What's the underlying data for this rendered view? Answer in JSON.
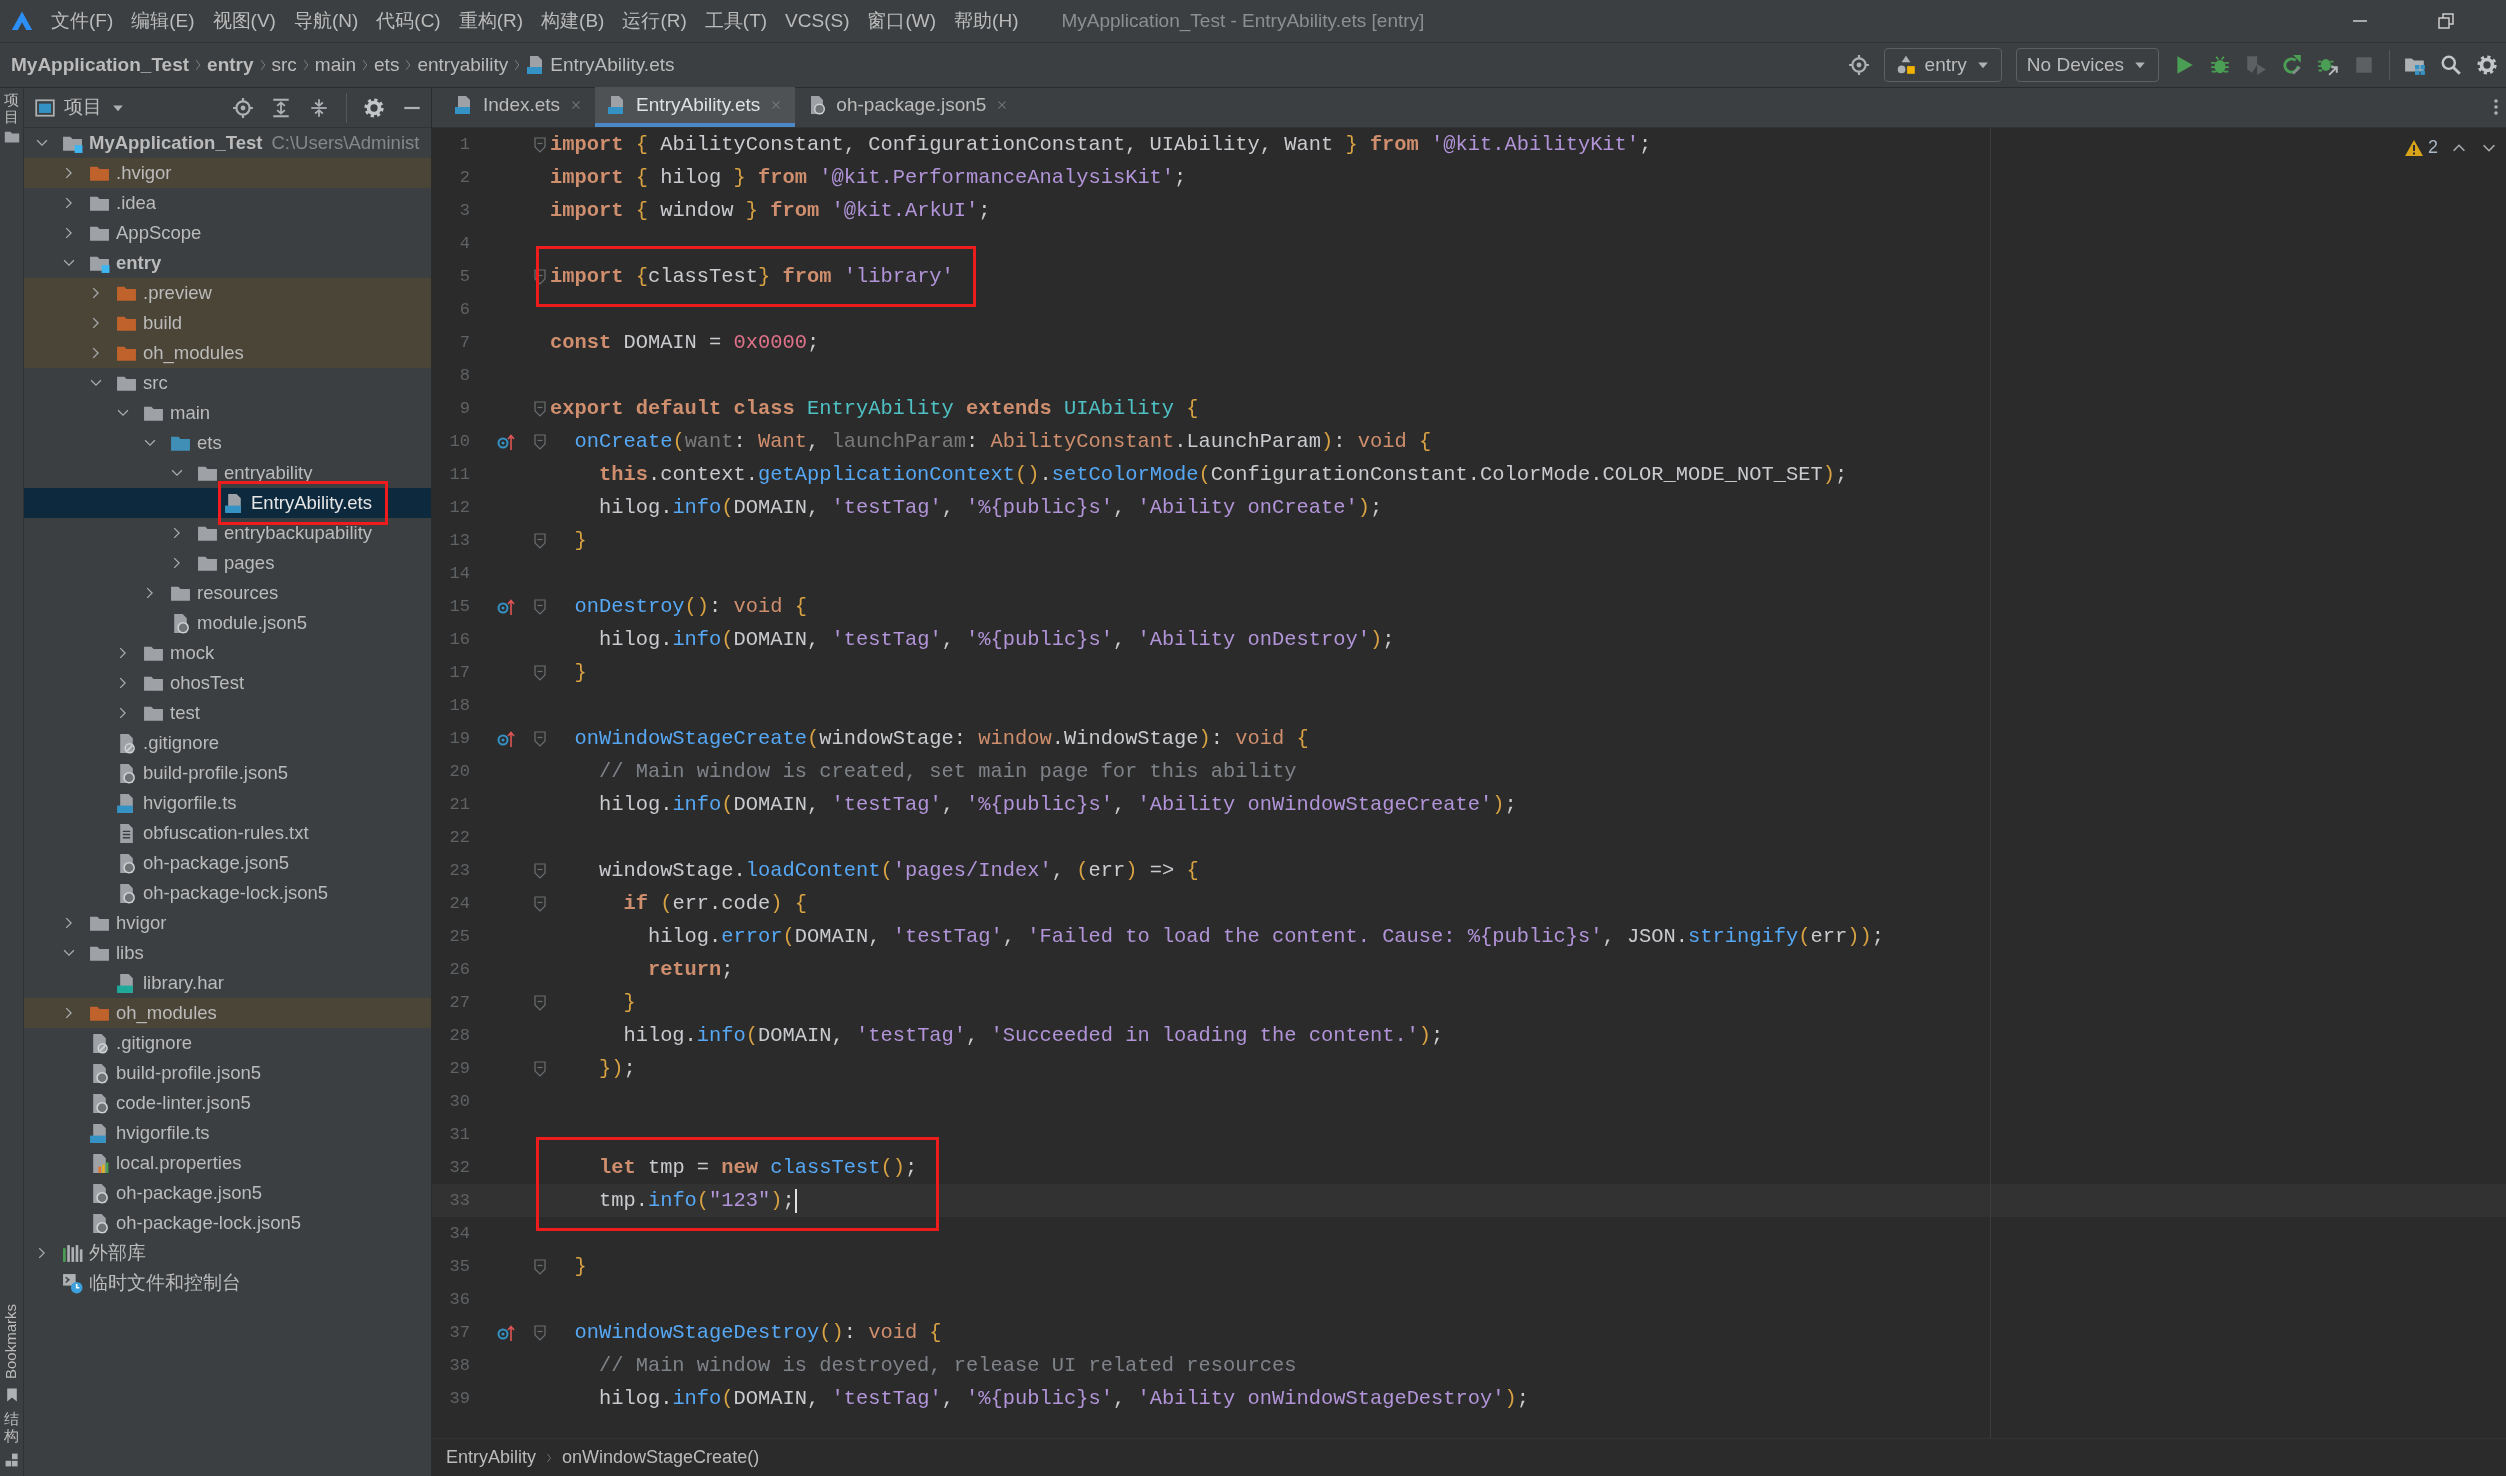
{
  "title_bar": {
    "menus": [
      "文件(F)",
      "编辑(E)",
      "视图(V)",
      "导航(N)",
      "代码(C)",
      "重构(R)",
      "构建(B)",
      "运行(R)",
      "工具(T)",
      "VCS(S)",
      "窗口(W)",
      "帮助(H)"
    ],
    "title": "MyApplication_Test - EntryAbility.ets [entry]"
  },
  "navigation_bar": {
    "breadcrumb": [
      {
        "label": "MyApplication_Test",
        "kind": "module"
      },
      {
        "label": "entry",
        "kind": "module"
      },
      {
        "label": "src",
        "kind": "dir"
      },
      {
        "label": "main",
        "kind": "dir"
      },
      {
        "label": "ets",
        "kind": "dir"
      },
      {
        "label": "entryability",
        "kind": "dir"
      },
      {
        "label": "EntryAbility.ets",
        "kind": "ets"
      }
    ],
    "run_config": "entry",
    "device": "No Devices"
  },
  "tool_strip": {
    "top_tab": "项目",
    "bottom_tabs": [
      {
        "label": "Bookmarks",
        "kind": "bookmarks"
      },
      {
        "label": "结构",
        "kind": "structure"
      }
    ]
  },
  "project_panel": {
    "title": "项目",
    "tree": [
      {
        "label": "MyApplication_Test",
        "kind": "module",
        "hint": "C:\\Users\\Administ",
        "expanded": true,
        "excluded": false,
        "selected": false,
        "boxed": false,
        "children": [
          {
            "label": ".hvigor",
            "kind": "folder",
            "expanded": false,
            "excluded": true,
            "selected": false,
            "boxed": false
          },
          {
            "label": ".idea",
            "kind": "folder",
            "expanded": false,
            "excluded": false,
            "selected": false,
            "boxed": false
          },
          {
            "label": "AppScope",
            "kind": "folder",
            "expanded": false,
            "excluded": false,
            "selected": false,
            "boxed": false
          },
          {
            "label": "entry",
            "kind": "module",
            "expanded": true,
            "excluded": false,
            "selected": false,
            "boxed": false,
            "children": [
              {
                "label": ".preview",
                "kind": "folder",
                "expanded": false,
                "excluded": true,
                "selected": false,
                "boxed": false
              },
              {
                "label": "build",
                "kind": "folder",
                "expanded": false,
                "excluded": true,
                "selected": false,
                "boxed": false
              },
              {
                "label": "oh_modules",
                "kind": "folder",
                "expanded": false,
                "excluded": true,
                "selected": false,
                "boxed": false
              },
              {
                "label": "src",
                "kind": "folder",
                "expanded": true,
                "excluded": false,
                "selected": false,
                "boxed": false,
                "children": [
                  {
                    "label": "main",
                    "kind": "folder",
                    "expanded": true,
                    "excluded": false,
                    "selected": false,
                    "boxed": false,
                    "children": [
                      {
                        "label": "ets",
                        "kind": "source",
                        "expanded": true,
                        "excluded": false,
                        "selected": false,
                        "boxed": false,
                        "children": [
                          {
                            "label": "entryability",
                            "kind": "folder",
                            "expanded": true,
                            "excluded": false,
                            "selected": false,
                            "boxed": false,
                            "children": [
                              {
                                "label": "EntryAbility.ets",
                                "kind": "ets",
                                "excluded": false,
                                "selected": true,
                                "boxed": true
                              }
                            ]
                          },
                          {
                            "label": "entrybackupability",
                            "kind": "folder",
                            "expanded": false,
                            "excluded": false,
                            "selected": false,
                            "boxed": false
                          },
                          {
                            "label": "pages",
                            "kind": "folder",
                            "expanded": false,
                            "excluded": false,
                            "selected": false,
                            "boxed": false
                          }
                        ]
                      },
                      {
                        "label": "resources",
                        "kind": "folder",
                        "expanded": false,
                        "excluded": false,
                        "selected": false,
                        "boxed": false
                      },
                      {
                        "label": "module.json5",
                        "kind": "json",
                        "excluded": false,
                        "selected": false,
                        "boxed": false
                      }
                    ]
                  },
                  {
                    "label": "mock",
                    "kind": "folder",
                    "expanded": false,
                    "excluded": false,
                    "selected": false,
                    "boxed": false
                  },
                  {
                    "label": "ohosTest",
                    "kind": "folder",
                    "expanded": false,
                    "excluded": false,
                    "selected": false,
                    "boxed": false
                  },
                  {
                    "label": "test",
                    "kind": "folder",
                    "expanded": false,
                    "excluded": false,
                    "selected": false,
                    "boxed": false
                  }
                ]
              },
              {
                "label": ".gitignore",
                "kind": "ignore",
                "excluded": false,
                "selected": false,
                "boxed": false
              },
              {
                "label": "build-profile.json5",
                "kind": "json",
                "excluded": false,
                "selected": false,
                "boxed": false
              },
              {
                "label": "hvigorfile.ts",
                "kind": "ts",
                "excluded": false,
                "selected": false,
                "boxed": false
              },
              {
                "label": "obfuscation-rules.txt",
                "kind": "txt",
                "excluded": false,
                "selected": false,
                "boxed": false
              },
              {
                "label": "oh-package.json5",
                "kind": "json",
                "excluded": false,
                "selected": false,
                "boxed": false
              },
              {
                "label": "oh-package-lock.json5",
                "kind": "json",
                "excluded": false,
                "selected": false,
                "boxed": false
              }
            ]
          },
          {
            "label": "hvigor",
            "kind": "folder",
            "expanded": false,
            "excluded": false,
            "selected": false,
            "boxed": false
          },
          {
            "label": "libs",
            "kind": "folder",
            "expanded": true,
            "excluded": false,
            "selected": false,
            "boxed": false,
            "children": [
              {
                "label": "library.har",
                "kind": "har",
                "excluded": false,
                "selected": false,
                "boxed": false
              }
            ]
          },
          {
            "label": "oh_modules",
            "kind": "folder",
            "expanded": false,
            "excluded": true,
            "selected": false,
            "boxed": false
          },
          {
            "label": ".gitignore",
            "kind": "ignore",
            "excluded": false,
            "selected": false,
            "boxed": false
          },
          {
            "label": "build-profile.json5",
            "kind": "json",
            "excluded": false,
            "selected": false,
            "boxed": false
          },
          {
            "label": "code-linter.json5",
            "kind": "json",
            "excluded": false,
            "selected": false,
            "boxed": false
          },
          {
            "label": "hvigorfile.ts",
            "kind": "ts",
            "excluded": false,
            "selected": false,
            "boxed": false
          },
          {
            "label": "local.properties",
            "kind": "properties",
            "excluded": false,
            "selected": false,
            "boxed": false
          },
          {
            "label": "oh-package.json5",
            "kind": "json",
            "excluded": false,
            "selected": false,
            "boxed": false
          },
          {
            "label": "oh-package-lock.json5",
            "kind": "json",
            "excluded": false,
            "selected": false,
            "boxed": false
          }
        ]
      },
      {
        "label": "外部库",
        "kind": "library",
        "expanded": false,
        "excluded": false,
        "selected": false,
        "boxed": false
      },
      {
        "label": "临时文件和控制台",
        "kind": "scratch",
        "excluded": false,
        "selected": false,
        "boxed": false
      }
    ]
  },
  "editor": {
    "tabs": [
      {
        "label": "Index.ets",
        "kind": "ets",
        "selected": false
      },
      {
        "label": "EntryAbility.ets",
        "kind": "ets",
        "selected": true
      },
      {
        "label": "oh-package.json5",
        "kind": "json",
        "selected": false
      }
    ],
    "warnings": "2",
    "lines": [
      {
        "number": "1",
        "fold": true,
        "override": false,
        "boxed": false,
        "current": false,
        "tokens": [
          {
            "kind": "kw",
            "text": "import "
          },
          {
            "kind": "br",
            "text": "{"
          },
          {
            "kind": "txt",
            "text": " AbilityConstant, ConfigurationConstant, UIAbility, Want "
          },
          {
            "kind": "br",
            "text": "} "
          },
          {
            "kind": "kw",
            "text": "from "
          },
          {
            "kind": "str",
            "text": "'@kit.AbilityKit'"
          },
          {
            "kind": "txt",
            "text": ";"
          }
        ]
      },
      {
        "number": "2",
        "fold": false,
        "override": false,
        "boxed": false,
        "current": false,
        "tokens": [
          {
            "kind": "kw",
            "text": "import "
          },
          {
            "kind": "br",
            "text": "{"
          },
          {
            "kind": "txt",
            "text": " hilog "
          },
          {
            "kind": "br",
            "text": "} "
          },
          {
            "kind": "kw",
            "text": "from "
          },
          {
            "kind": "str",
            "text": "'@kit.PerformanceAnalysisKit'"
          },
          {
            "kind": "txt",
            "text": ";"
          }
        ]
      },
      {
        "number": "3",
        "fold": false,
        "override": false,
        "boxed": false,
        "current": false,
        "tokens": [
          {
            "kind": "kw",
            "text": "import "
          },
          {
            "kind": "br",
            "text": "{"
          },
          {
            "kind": "txt",
            "text": " window "
          },
          {
            "kind": "br",
            "text": "} "
          },
          {
            "kind": "kw",
            "text": "from "
          },
          {
            "kind": "str",
            "text": "'@kit.ArkUI'"
          },
          {
            "kind": "txt",
            "text": ";"
          }
        ]
      },
      {
        "number": "4",
        "fold": false,
        "override": false,
        "boxed": false,
        "current": false
      },
      {
        "number": "5",
        "fold": true,
        "override": false,
        "boxed": true,
        "current": false,
        "tokens": [
          {
            "kind": "kw",
            "text": "import "
          },
          {
            "kind": "br",
            "text": "{"
          },
          {
            "kind": "txt",
            "text": "classTest"
          },
          {
            "kind": "br",
            "text": "} "
          },
          {
            "kind": "kw",
            "text": "from "
          },
          {
            "kind": "str",
            "text": "'library'"
          }
        ]
      },
      {
        "number": "6",
        "fold": false,
        "override": false,
        "boxed": false,
        "current": false
      },
      {
        "number": "7",
        "fold": false,
        "override": false,
        "boxed": false,
        "current": false,
        "tokens": [
          {
            "kind": "kw",
            "text": "const "
          },
          {
            "kind": "txt",
            "text": "DOMAIN = "
          },
          {
            "kind": "num",
            "text": "0x0000"
          },
          {
            "kind": "txt",
            "text": ";"
          }
        ]
      },
      {
        "number": "8",
        "fold": false,
        "override": false,
        "boxed": false,
        "current": false
      },
      {
        "number": "9",
        "fold": true,
        "override": false,
        "boxed": false,
        "current": false,
        "tokens": [
          {
            "kind": "kw",
            "text": "export default class "
          },
          {
            "kind": "cls",
            "text": "EntryAbility "
          },
          {
            "kind": "kw",
            "text": "extends "
          },
          {
            "kind": "cls",
            "text": "UIAbility "
          },
          {
            "kind": "br",
            "text": "{"
          }
        ]
      },
      {
        "number": "10",
        "fold": true,
        "override": true,
        "boxed": false,
        "current": false,
        "tokens": [
          {
            "kind": "fn",
            "text": "  onCreate"
          },
          {
            "kind": "br",
            "text": "("
          },
          {
            "kind": "par",
            "text": "want"
          },
          {
            "kind": "txt",
            "text": ": "
          },
          {
            "kind": "typ",
            "text": "Want"
          },
          {
            "kind": "txt",
            "text": ", "
          },
          {
            "kind": "par",
            "text": "launchParam"
          },
          {
            "kind": "txt",
            "text": ": "
          },
          {
            "kind": "typ",
            "text": "AbilityConstant"
          },
          {
            "kind": "txt",
            "text": ".LaunchParam"
          },
          {
            "kind": "br",
            "text": ")"
          },
          {
            "kind": "txt",
            "text": ": "
          },
          {
            "kind": "typ",
            "text": "void "
          },
          {
            "kind": "br",
            "text": "{"
          }
        ]
      },
      {
        "number": "11",
        "fold": false,
        "override": false,
        "boxed": false,
        "current": false,
        "tokens": [
          {
            "kind": "kw",
            "text": "    this"
          },
          {
            "kind": "txt",
            "text": ".context."
          },
          {
            "kind": "fn",
            "text": "getApplicationContext"
          },
          {
            "kind": "br",
            "text": "()"
          },
          {
            "kind": "txt",
            "text": "."
          },
          {
            "kind": "fn",
            "text": "setColorMode"
          },
          {
            "kind": "br",
            "text": "("
          },
          {
            "kind": "txt",
            "text": "ConfigurationConstant.ColorMode.COLOR_MODE_NOT_SET"
          },
          {
            "kind": "br",
            "text": ")"
          },
          {
            "kind": "txt",
            "text": ";"
          }
        ]
      },
      {
        "number": "12",
        "fold": false,
        "override": false,
        "boxed": false,
        "current": false,
        "tokens": [
          {
            "kind": "txt",
            "text": "    hilog."
          },
          {
            "kind": "fn",
            "text": "info"
          },
          {
            "kind": "br",
            "text": "("
          },
          {
            "kind": "txt",
            "text": "DOMAIN, "
          },
          {
            "kind": "str",
            "text": "'testTag'"
          },
          {
            "kind": "txt",
            "text": ", "
          },
          {
            "kind": "str",
            "text": "'%{public}s'"
          },
          {
            "kind": "txt",
            "text": ", "
          },
          {
            "kind": "str",
            "text": "'Ability onCreate'"
          },
          {
            "kind": "br",
            "text": ")"
          },
          {
            "kind": "txt",
            "text": ";"
          }
        ]
      },
      {
        "number": "13",
        "fold": true,
        "override": false,
        "boxed": false,
        "current": false,
        "tokens": [
          {
            "kind": "br",
            "text": "  }"
          }
        ]
      },
      {
        "number": "14",
        "fold": false,
        "override": false,
        "boxed": false,
        "current": false
      },
      {
        "number": "15",
        "fold": true,
        "override": true,
        "boxed": false,
        "current": false,
        "tokens": [
          {
            "kind": "fn",
            "text": "  onDestroy"
          },
          {
            "kind": "br",
            "text": "()"
          },
          {
            "kind": "txt",
            "text": ": "
          },
          {
            "kind": "typ",
            "text": "void "
          },
          {
            "kind": "br",
            "text": "{"
          }
        ]
      },
      {
        "number": "16",
        "fold": false,
        "override": false,
        "boxed": false,
        "current": false,
        "tokens": [
          {
            "kind": "txt",
            "text": "    hilog."
          },
          {
            "kind": "fn",
            "text": "info"
          },
          {
            "kind": "br",
            "text": "("
          },
          {
            "kind": "txt",
            "text": "DOMAIN, "
          },
          {
            "kind": "str",
            "text": "'testTag'"
          },
          {
            "kind": "txt",
            "text": ", "
          },
          {
            "kind": "str",
            "text": "'%{public}s'"
          },
          {
            "kind": "txt",
            "text": ", "
          },
          {
            "kind": "str",
            "text": "'Ability onDestroy'"
          },
          {
            "kind": "br",
            "text": ")"
          },
          {
            "kind": "txt",
            "text": ";"
          }
        ]
      },
      {
        "number": "17",
        "fold": true,
        "override": false,
        "boxed": false,
        "current": false,
        "tokens": [
          {
            "kind": "br",
            "text": "  }"
          }
        ]
      },
      {
        "number": "18",
        "fold": false,
        "override": false,
        "boxed": false,
        "current": false
      },
      {
        "number": "19",
        "fold": true,
        "override": true,
        "boxed": false,
        "current": false,
        "tokens": [
          {
            "kind": "fn",
            "text": "  onWindowStageCreate"
          },
          {
            "kind": "br",
            "text": "("
          },
          {
            "kind": "txt",
            "text": "windowStage: "
          },
          {
            "kind": "typ",
            "text": "window"
          },
          {
            "kind": "txt",
            "text": ".WindowStage"
          },
          {
            "kind": "br",
            "text": ")"
          },
          {
            "kind": "txt",
            "text": ": "
          },
          {
            "kind": "typ",
            "text": "void "
          },
          {
            "kind": "br",
            "text": "{"
          }
        ]
      },
      {
        "number": "20",
        "fold": false,
        "override": false,
        "boxed": false,
        "current": false,
        "tokens": [
          {
            "kind": "com",
            "text": "    // Main window is created, set main page for this ability"
          }
        ]
      },
      {
        "number": "21",
        "fold": false,
        "override": false,
        "boxed": false,
        "current": false,
        "tokens": [
          {
            "kind": "txt",
            "text": "    hilog."
          },
          {
            "kind": "fn",
            "text": "info"
          },
          {
            "kind": "br",
            "text": "("
          },
          {
            "kind": "txt",
            "text": "DOMAIN, "
          },
          {
            "kind": "str",
            "text": "'testTag'"
          },
          {
            "kind": "txt",
            "text": ", "
          },
          {
            "kind": "str",
            "text": "'%{public}s'"
          },
          {
            "kind": "txt",
            "text": ", "
          },
          {
            "kind": "str",
            "text": "'Ability onWindowStageCreate'"
          },
          {
            "kind": "br",
            "text": ")"
          },
          {
            "kind": "txt",
            "text": ";"
          }
        ]
      },
      {
        "number": "22",
        "fold": false,
        "override": false,
        "boxed": false,
        "current": false
      },
      {
        "number": "23",
        "fold": true,
        "override": false,
        "boxed": false,
        "current": false,
        "tokens": [
          {
            "kind": "txt",
            "text": "    windowStage."
          },
          {
            "kind": "fn",
            "text": "loadContent"
          },
          {
            "kind": "br",
            "text": "("
          },
          {
            "kind": "str",
            "text": "'pages/Index'"
          },
          {
            "kind": "txt",
            "text": ", "
          },
          {
            "kind": "br",
            "text": "("
          },
          {
            "kind": "txt",
            "text": "err"
          },
          {
            "kind": "br",
            "text": ")"
          },
          {
            "kind": "txt",
            "text": " => "
          },
          {
            "kind": "br",
            "text": "{"
          }
        ]
      },
      {
        "number": "24",
        "fold": true,
        "override": false,
        "boxed": false,
        "current": false,
        "tokens": [
          {
            "kind": "kw",
            "text": "      if "
          },
          {
            "kind": "br",
            "text": "("
          },
          {
            "kind": "txt",
            "text": "err.code"
          },
          {
            "kind": "br",
            "text": ") {"
          }
        ]
      },
      {
        "number": "25",
        "fold": false,
        "override": false,
        "boxed": false,
        "current": false,
        "tokens": [
          {
            "kind": "txt",
            "text": "        hilog."
          },
          {
            "kind": "fn",
            "text": "error"
          },
          {
            "kind": "br",
            "text": "("
          },
          {
            "kind": "txt",
            "text": "DOMAIN, "
          },
          {
            "kind": "str",
            "text": "'testTag'"
          },
          {
            "kind": "txt",
            "text": ", "
          },
          {
            "kind": "str",
            "text": "'Failed to load the content. Cause: %{public}s'"
          },
          {
            "kind": "txt",
            "text": ", JSON."
          },
          {
            "kind": "fn",
            "text": "stringify"
          },
          {
            "kind": "br",
            "text": "("
          },
          {
            "kind": "txt",
            "text": "err"
          },
          {
            "kind": "br",
            "text": "))"
          },
          {
            "kind": "txt",
            "text": ";"
          }
        ]
      },
      {
        "number": "26",
        "fold": false,
        "override": false,
        "boxed": false,
        "current": false,
        "tokens": [
          {
            "kind": "kw",
            "text": "        return"
          },
          {
            "kind": "txt",
            "text": ";"
          }
        ]
      },
      {
        "number": "27",
        "fold": true,
        "override": false,
        "boxed": false,
        "current": false,
        "tokens": [
          {
            "kind": "br",
            "text": "      }"
          }
        ]
      },
      {
        "number": "28",
        "fold": false,
        "override": false,
        "boxed": false,
        "current": false,
        "tokens": [
          {
            "kind": "txt",
            "text": "      hilog."
          },
          {
            "kind": "fn",
            "text": "info"
          },
          {
            "kind": "br",
            "text": "("
          },
          {
            "kind": "txt",
            "text": "DOMAIN, "
          },
          {
            "kind": "str",
            "text": "'testTag'"
          },
          {
            "kind": "txt",
            "text": ", "
          },
          {
            "kind": "str",
            "text": "'Succeeded in loading the content.'"
          },
          {
            "kind": "br",
            "text": ")"
          },
          {
            "kind": "txt",
            "text": ";"
          }
        ]
      },
      {
        "number": "29",
        "fold": true,
        "override": false,
        "boxed": false,
        "current": false,
        "tokens": [
          {
            "kind": "br",
            "text": "    })"
          },
          {
            "kind": "txt",
            "text": ";"
          }
        ]
      },
      {
        "number": "30",
        "fold": false,
        "override": false,
        "boxed": false,
        "current": false
      },
      {
        "number": "31",
        "fold": false,
        "override": false,
        "boxed": false,
        "current": false
      },
      {
        "number": "32",
        "fold": false,
        "override": false,
        "boxed": true,
        "current": false,
        "tokens": [
          {
            "kind": "kw",
            "text": "    let "
          },
          {
            "kind": "txt",
            "text": "tmp = "
          },
          {
            "kind": "kw",
            "text": "new "
          },
          {
            "kind": "fn",
            "text": "classTest"
          },
          {
            "kind": "br",
            "text": "()"
          },
          {
            "kind": "txt",
            "text": ";"
          }
        ]
      },
      {
        "number": "33",
        "fold": false,
        "override": false,
        "boxed": true,
        "current": true,
        "tokens": [
          {
            "kind": "txt",
            "text": "    tmp."
          },
          {
            "kind": "fn",
            "text": "info"
          },
          {
            "kind": "br",
            "text": "("
          },
          {
            "kind": "str",
            "text": "\"123\""
          },
          {
            "kind": "br",
            "text": ")"
          },
          {
            "kind": "txt",
            "text": ";"
          }
        ]
      },
      {
        "number": "34",
        "fold": false,
        "override": false,
        "boxed": false,
        "current": false
      },
      {
        "number": "35",
        "fold": true,
        "override": false,
        "boxed": false,
        "current": false,
        "tokens": [
          {
            "kind": "br",
            "text": "  }"
          }
        ]
      },
      {
        "number": "36",
        "fold": false,
        "override": false,
        "boxed": false,
        "current": false
      },
      {
        "number": "37",
        "fold": true,
        "override": true,
        "boxed": false,
        "current": false,
        "tokens": [
          {
            "kind": "fn",
            "text": "  onWindowStageDestroy"
          },
          {
            "kind": "br",
            "text": "()"
          },
          {
            "kind": "txt",
            "text": ": "
          },
          {
            "kind": "typ",
            "text": "void "
          },
          {
            "kind": "br",
            "text": "{"
          }
        ]
      },
      {
        "number": "38",
        "fold": false,
        "override": false,
        "boxed": false,
        "current": false,
        "tokens": [
          {
            "kind": "com",
            "text": "    // Main window is destroyed, release UI related resources"
          }
        ]
      },
      {
        "number": "39",
        "fold": false,
        "override": false,
        "boxed": false,
        "current": false,
        "tokens": [
          {
            "kind": "txt",
            "text": "    hilog."
          },
          {
            "kind": "fn",
            "text": "info"
          },
          {
            "kind": "br",
            "text": "("
          },
          {
            "kind": "txt",
            "text": "DOMAIN, "
          },
          {
            "kind": "str",
            "text": "'testTag'"
          },
          {
            "kind": "txt",
            "text": ", "
          },
          {
            "kind": "str",
            "text": "'%{public}s'"
          },
          {
            "kind": "txt",
            "text": ", "
          },
          {
            "kind": "str",
            "text": "'Ability onWindowStageDestroy'"
          },
          {
            "kind": "br",
            "text": ")"
          },
          {
            "kind": "txt",
            "text": ";"
          }
        ]
      }
    ],
    "breadcrumb": [
      "EntryAbility",
      "onWindowStageCreate()"
    ]
  }
}
